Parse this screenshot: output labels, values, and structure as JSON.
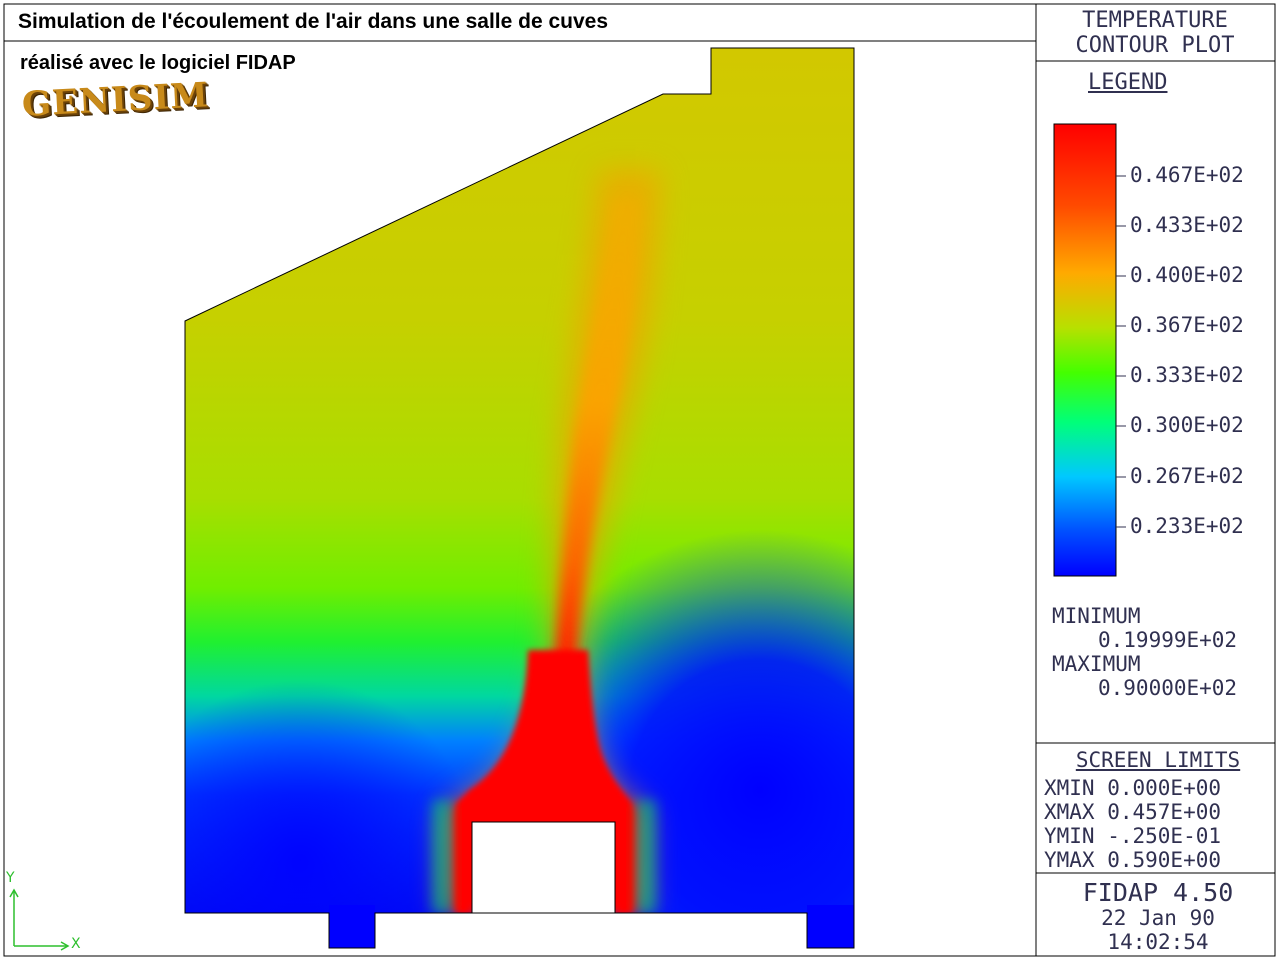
{
  "header": {
    "title": "Simulation de l'écoulement de l'air dans une salle de cuves",
    "subtitle": "réalisé avec le logiciel FIDAP",
    "logo_text": "GENISIM"
  },
  "plot_panel": {
    "title_line1": "TEMPERATURE",
    "title_line2": "CONTOUR PLOT",
    "legend_title": "LEGEND",
    "legend_ticks": [
      "0.467E+02",
      "0.433E+02",
      "0.400E+02",
      "0.367E+02",
      "0.333E+02",
      "0.300E+02",
      "0.267E+02",
      "0.233E+02"
    ],
    "minimum_label": "MINIMUM",
    "minimum_value": "0.19999E+02",
    "maximum_label": "MAXIMUM",
    "maximum_value": "0.90000E+02"
  },
  "screen_limits": {
    "title": "SCREEN LIMITS",
    "rows": [
      "XMIN 0.000E+00",
      "XMAX 0.457E+00",
      "YMIN -.250E-01",
      "YMAX 0.590E+00"
    ]
  },
  "footer": {
    "version": "FIDAP 4.50",
    "date": "22 Jan 90",
    "time": "14:02:54"
  },
  "axes": {
    "y_label": "Y",
    "x_label": "X"
  },
  "colors": {
    "hot": "#ff0000",
    "warm": "#ffa500",
    "mid": "#c8d400",
    "green": "#00ff00",
    "cool": "#00c8ff",
    "cold": "#0000ff"
  }
}
